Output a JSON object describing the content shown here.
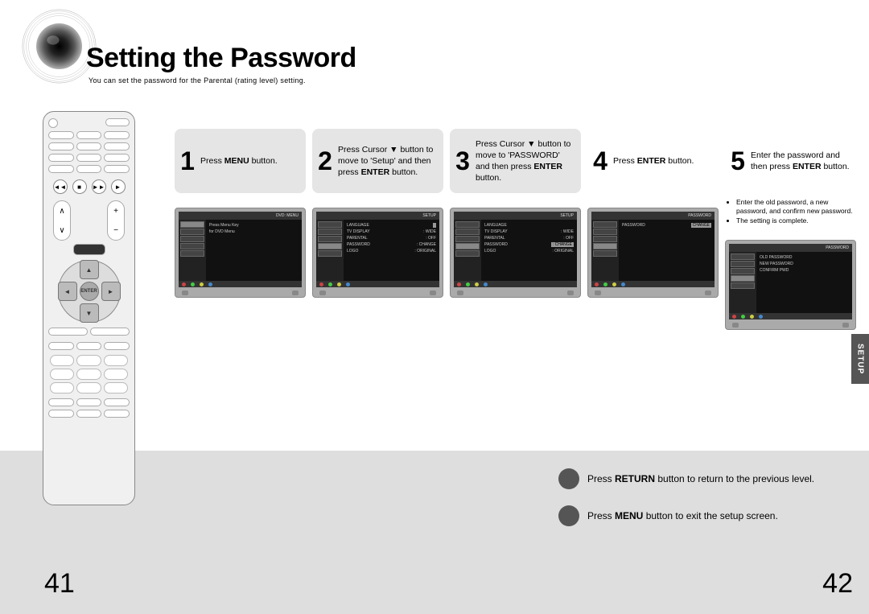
{
  "title": "Setting the Password",
  "subtitle": "You can set the password for the Parental (rating level) setting.",
  "side_tab": "SETUP",
  "page_left": "41",
  "page_right": "42",
  "steps": [
    {
      "num": "1",
      "html": "Press <b>MENU</b> button.",
      "screen": {
        "header_left": "",
        "header_right": "DVD: MENU",
        "left_hl": 0,
        "main_lines": [
          [
            "Press Menu Key",
            ""
          ],
          [
            "for DVD Menu",
            ""
          ]
        ],
        "main_hl": -1
      }
    },
    {
      "num": "2",
      "html": "Press Cursor ▼ button to move to 'Setup' and then press <b>ENTER</b> button.",
      "screen": {
        "header_left": "",
        "header_right": "SETUP",
        "left_hl": 3,
        "main_lines": [
          [
            "LANGUAGE",
            ""
          ],
          [
            "TV DISPLAY",
            ": WIDE"
          ],
          [
            "PARENTAL",
            ": OFF"
          ],
          [
            "PASSWORD",
            ": CHANGE"
          ],
          [
            "LOGO",
            ": ORIGINAL"
          ]
        ],
        "main_hl": 0
      }
    },
    {
      "num": "3",
      "html": "Press Cursor ▼ button to move to 'PASSWORD' and then press <b>ENTER</b> button.",
      "screen": {
        "header_left": "",
        "header_right": "SETUP",
        "left_hl": 3,
        "main_lines": [
          [
            "LANGUAGE",
            ""
          ],
          [
            "TV DISPLAY",
            ": WIDE"
          ],
          [
            "PARENTAL",
            ": OFF"
          ],
          [
            "PASSWORD",
            ": CHANGE"
          ],
          [
            "LOGO",
            ": ORIGINAL"
          ]
        ],
        "main_hl": 3
      }
    },
    {
      "num": "4",
      "html": "Press <b>ENTER</b> button.",
      "screen": {
        "header_left": "",
        "header_right": "PASSWORD",
        "left_hl": 3,
        "main_lines": [
          [
            "PASSWORD",
            "CHANGE"
          ]
        ],
        "main_hl": 0
      }
    },
    {
      "num": "5",
      "html": "Enter the password and then press <b>ENTER</b> button.",
      "notes": [
        "Enter the old password, a new password, and confirm new password.",
        "The setting is complete."
      ],
      "screen": {
        "header_left": "",
        "header_right": "PASSWORD",
        "left_hl": 3,
        "main_lines": [
          [
            "OLD PASSWORD",
            ""
          ],
          [
            "NEW PASSWORD",
            ""
          ],
          [
            "CONFIRM PWD",
            ""
          ]
        ],
        "main_hl": -1
      }
    }
  ],
  "footer_notes": [
    "Press <b>RETURN</b> button to return to the previous level.",
    "Press <b>MENU</b> button to exit the setup screen."
  ],
  "remote": {
    "enter_label": "ENTER"
  }
}
